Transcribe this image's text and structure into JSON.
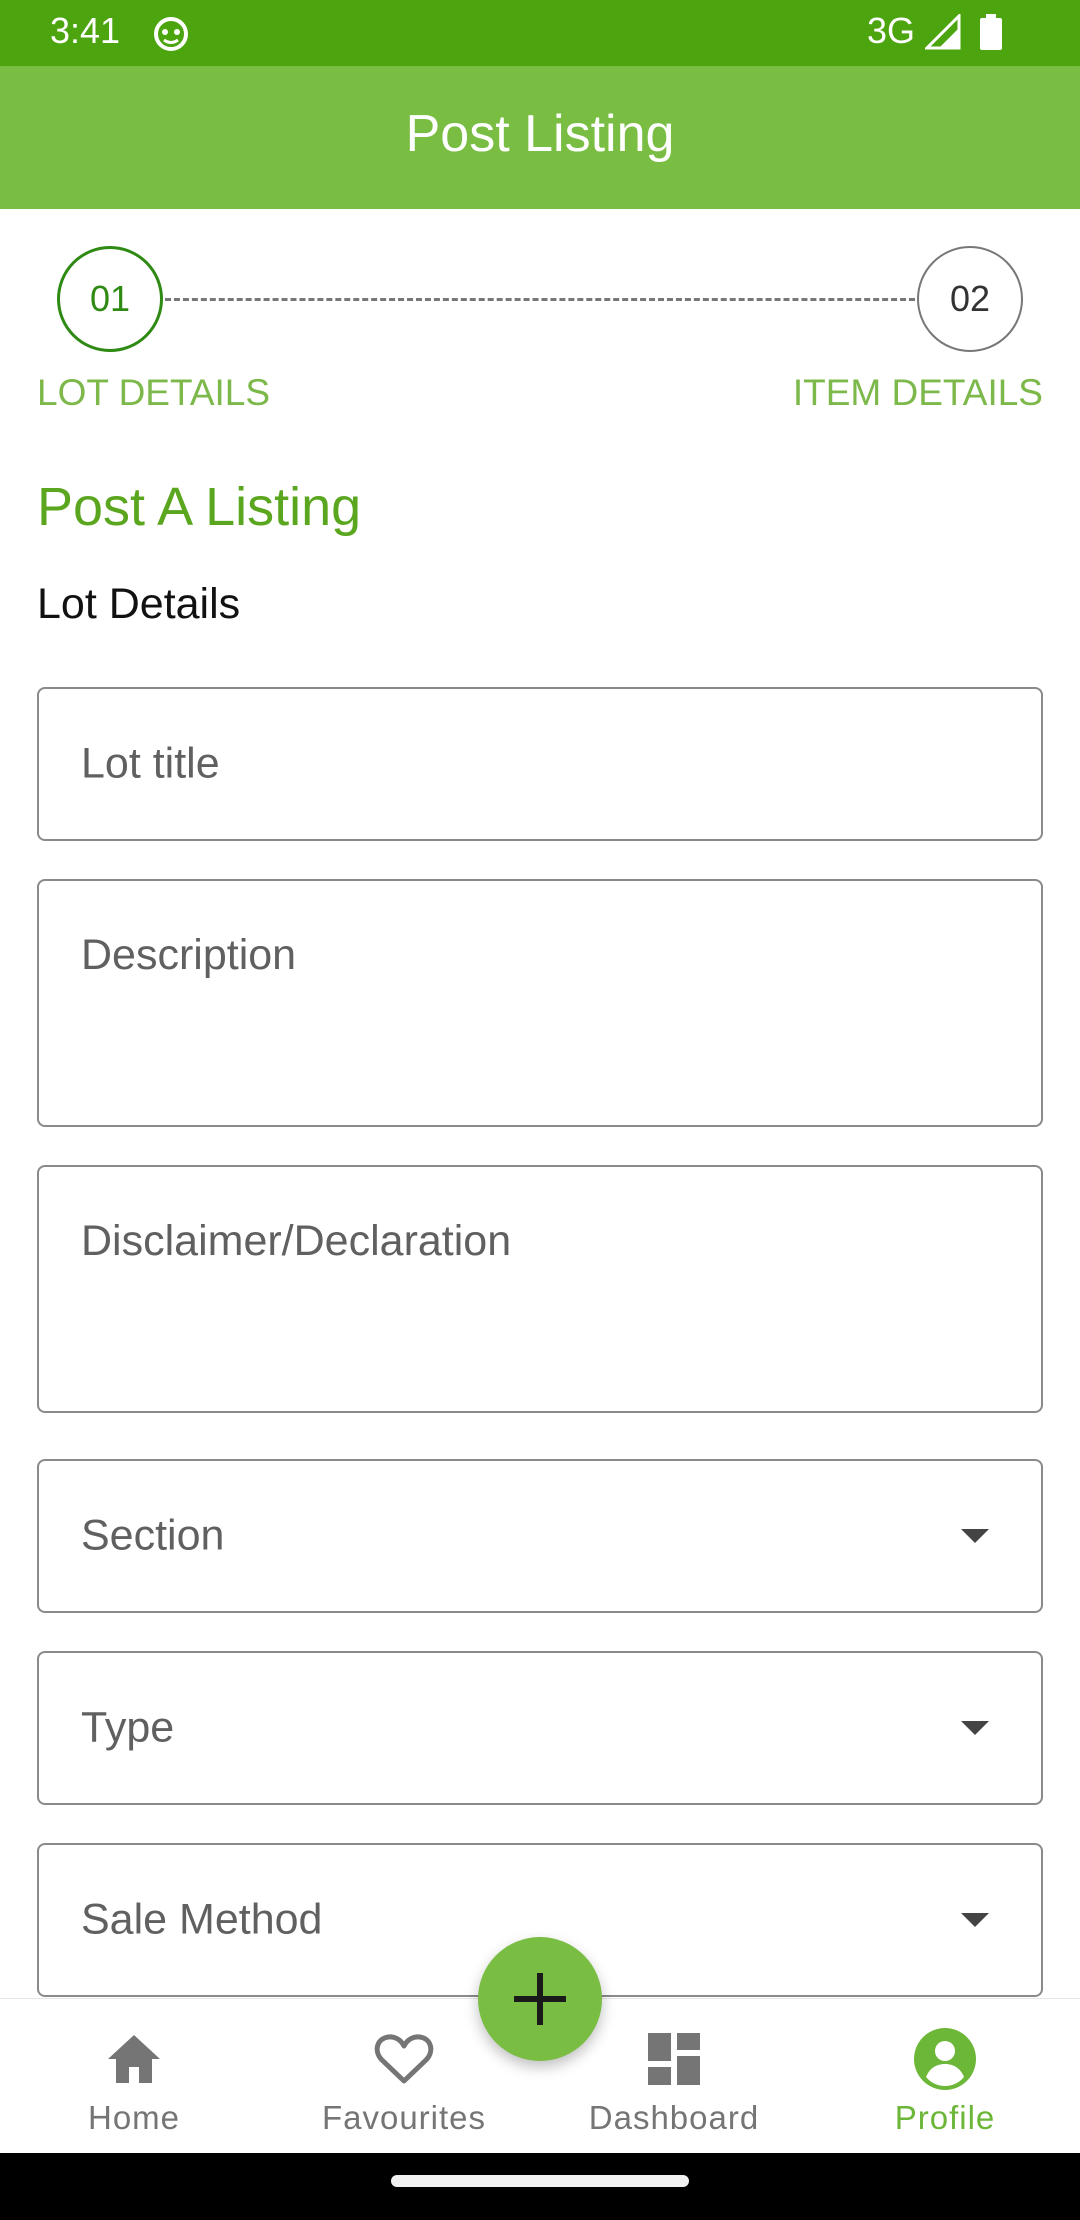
{
  "status_bar": {
    "time": "3:41",
    "network": "3G",
    "icons": [
      "app-notification-icon",
      "signal-icon",
      "battery-icon"
    ]
  },
  "app_bar": {
    "title": "Post Listing"
  },
  "stepper": {
    "steps": [
      {
        "number": "01",
        "label": "LOT DETAILS",
        "active": true
      },
      {
        "number": "02",
        "label": "ITEM DETAILS",
        "active": false
      }
    ]
  },
  "form": {
    "heading": "Post A Listing",
    "section_title": "Lot Details",
    "fields": {
      "lot_title": {
        "placeholder": "Lot title",
        "value": ""
      },
      "description": {
        "placeholder": "Description",
        "value": ""
      },
      "disclaimer": {
        "placeholder": "Disclaimer/Declaration",
        "value": ""
      },
      "section": {
        "placeholder": "Section",
        "value": ""
      },
      "type": {
        "placeholder": "Type",
        "value": ""
      },
      "sale_method": {
        "placeholder": "Sale Method",
        "value": ""
      }
    }
  },
  "bottom_nav": {
    "items": [
      {
        "label": "Home",
        "icon": "home-icon"
      },
      {
        "label": "Favourites",
        "icon": "heart-icon"
      },
      {
        "label": "Dashboard",
        "icon": "dashboard-icon"
      },
      {
        "label": "Profile",
        "icon": "profile-icon",
        "active": true
      }
    ],
    "fab_icon": "plus-icon"
  },
  "colors": {
    "status_bar": "#4ca40e",
    "app_bar": "#79bd43",
    "accent_green": "#5aa61e",
    "step_active": "#2f8a14"
  }
}
